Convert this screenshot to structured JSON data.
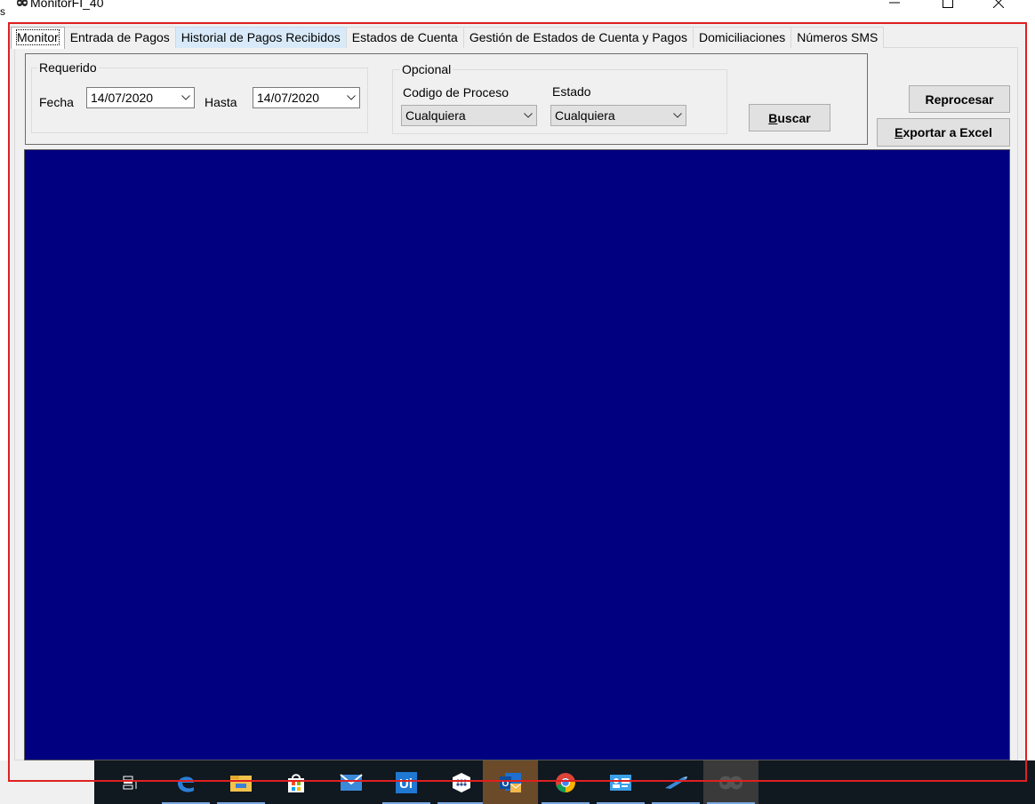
{
  "window": {
    "left_clip_text": "s",
    "title": "MonitorFI_40",
    "minimize_glyph": "—",
    "maximize_glyph": "☐",
    "close_glyph": "✕"
  },
  "tabs": [
    {
      "label": "Monitor",
      "state": "active"
    },
    {
      "label": "Entrada de Pagos",
      "state": "normal"
    },
    {
      "label": "Historial de Pagos Recibidos",
      "state": "hover"
    },
    {
      "label": "Estados de Cuenta",
      "state": "normal"
    },
    {
      "label": "Gestión de Estados de Cuenta y Pagos",
      "state": "normal"
    },
    {
      "label": "Domiciliaciones",
      "state": "normal"
    },
    {
      "label": "Números SMS",
      "state": "normal"
    }
  ],
  "required": {
    "legend": "Requerido",
    "fecha_label": "Fecha",
    "fecha_value": "14/07/2020",
    "hasta_label": "Hasta",
    "hasta_value": "14/07/2020"
  },
  "optional": {
    "legend": "Opcional",
    "codigo_label": "Codigo de Proceso",
    "codigo_value": "Cualquiera",
    "estado_label": "Estado",
    "estado_value": "Cualquiera"
  },
  "buttons": {
    "buscar_ul": "B",
    "buscar_rest": "uscar",
    "reprocesar": "Reprocesar",
    "exportar_ul": "E",
    "exportar_rest": "xportar a Excel"
  },
  "colors": {
    "grid_background": "#000080",
    "highlight": "#e02020",
    "taskbar": "#101820"
  },
  "taskbar_icons": [
    "task-view-icon",
    "edge-icon",
    "file-explorer-icon",
    "store-icon",
    "mail-icon",
    "uipath-icon",
    "app-grid-icon",
    "outlook-icon",
    "chrome-icon",
    "contacts-icon",
    "pen-app-icon",
    "monitor-app-icon"
  ]
}
